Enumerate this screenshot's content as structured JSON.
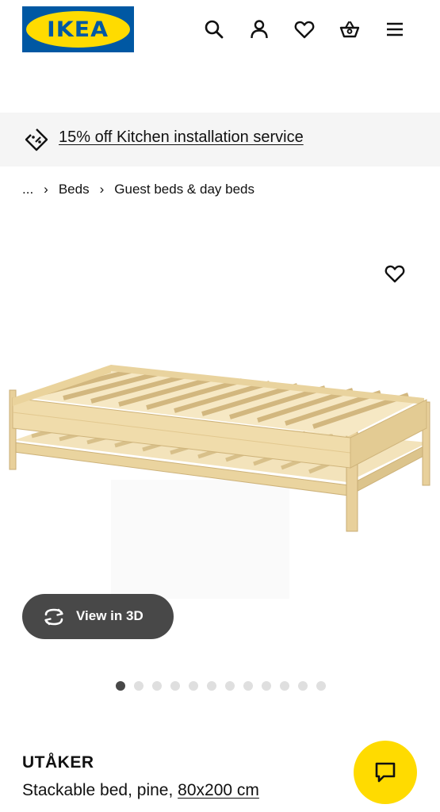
{
  "header": {
    "logo_text": "IKEA",
    "icons": [
      "search-icon",
      "account-icon",
      "heart-icon",
      "basket-icon",
      "menu-icon"
    ]
  },
  "promo": {
    "label": "15% off Kitchen installation service",
    "icon": "tag-icon"
  },
  "breadcrumb": {
    "items": [
      "...",
      "Beds",
      "Guest beds & day beds"
    ]
  },
  "gallery": {
    "view_3d_label": "View in 3D",
    "dot_count": 12,
    "active_index": 0
  },
  "product": {
    "name": "UTÅKER",
    "description": "Stackable bed, pine,",
    "size": "80x200 cm"
  },
  "colors": {
    "brand_blue": "#0058a3",
    "brand_yellow": "#ffdb00",
    "dark_button": "#484848",
    "promo_bg": "#f5f5f5"
  }
}
